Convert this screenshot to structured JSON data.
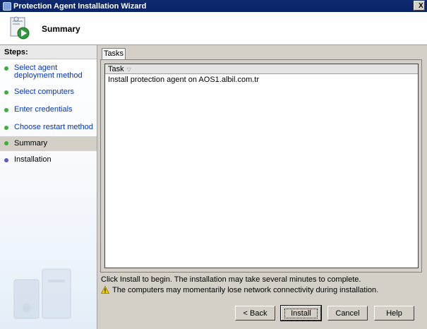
{
  "window": {
    "title": "Protection Agent Installation Wizard",
    "close_label": "X"
  },
  "header": {
    "title": "Summary",
    "icon": "wizard-install-icon"
  },
  "sidebar": {
    "heading": "Steps:",
    "steps": [
      {
        "label": "Select agent deployment method",
        "state": "done"
      },
      {
        "label": "Select computers",
        "state": "done"
      },
      {
        "label": "Enter credentials",
        "state": "done"
      },
      {
        "label": "Choose restart method",
        "state": "done"
      },
      {
        "label": "Summary",
        "state": "current"
      },
      {
        "label": "Installation",
        "state": "pending"
      }
    ]
  },
  "tabs": [
    {
      "label": "Tasks",
      "selected": true
    }
  ],
  "task_list": {
    "column": "Task",
    "rows": [
      "Install protection agent on AOS1.albil.com.tr"
    ]
  },
  "messages": {
    "info": "Click Install to begin. The installation may take several minutes to complete.",
    "warning": "The computers may momentarily lose network connectivity during installation."
  },
  "buttons": {
    "back": "< Back",
    "install": "Install",
    "cancel": "Cancel",
    "help": "Help"
  },
  "colors": {
    "titlebar": "#0a246a",
    "link": "#0033cc",
    "done_dot": "#3bb13b",
    "pending_dot": "#5a5ac8"
  }
}
